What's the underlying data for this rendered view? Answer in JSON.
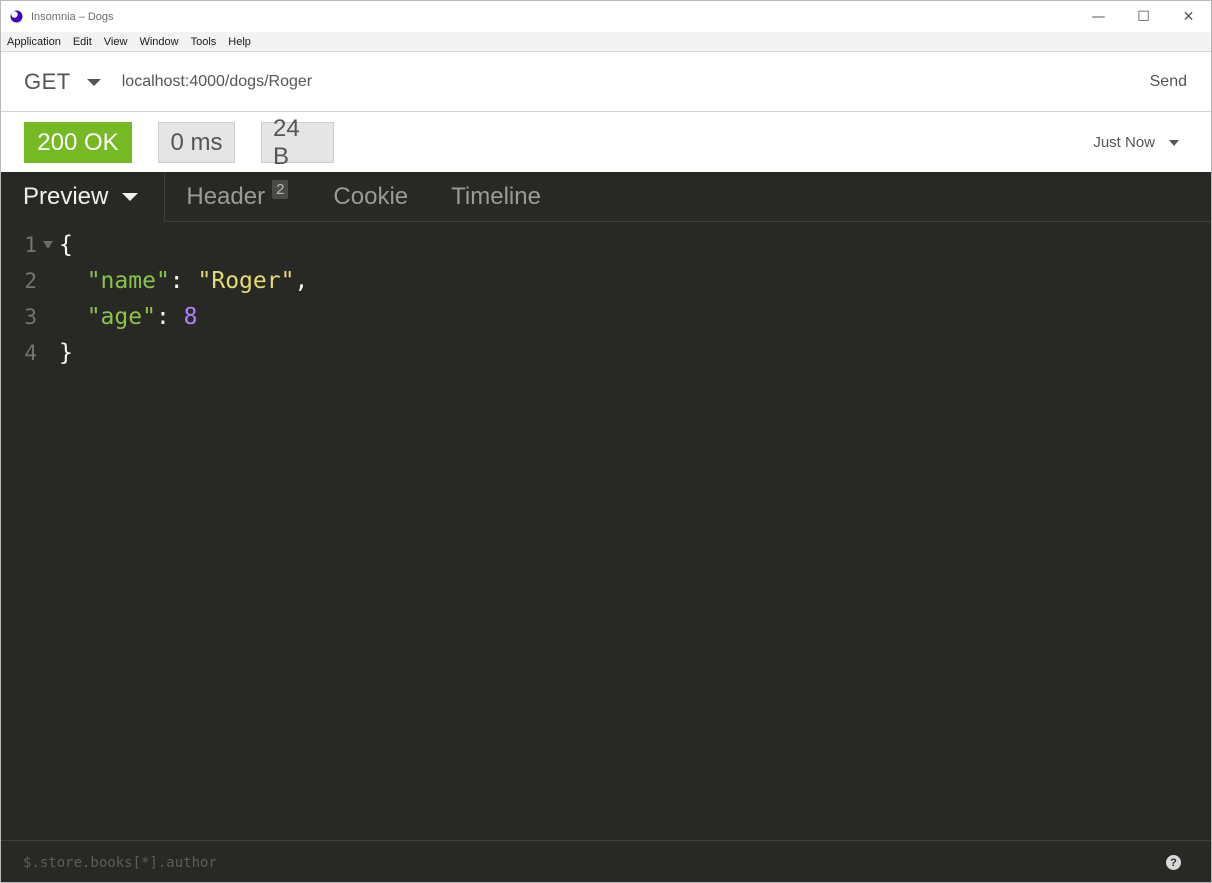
{
  "window": {
    "title": "Insomnia – Dogs",
    "controls": {
      "minimize": "—",
      "maximize": "☐",
      "close": "✕"
    }
  },
  "menu": [
    "Application",
    "Edit",
    "View",
    "Window",
    "Tools",
    "Help"
  ],
  "request": {
    "method": "GET",
    "url": "localhost:4000/dogs/Roger",
    "send_label": "Send"
  },
  "response": {
    "status": "200 OK",
    "status_color": "#75ba24",
    "time": "0 ms",
    "size": "24 B",
    "history": "Just Now"
  },
  "tabs": {
    "preview": "Preview",
    "header": "Header",
    "header_count": "2",
    "cookie": "Cookie",
    "timeline": "Timeline"
  },
  "body": {
    "lines": [
      "1",
      "2",
      "3",
      "4"
    ],
    "open_brace": "{",
    "close_brace": "}",
    "key_name": "\"name\"",
    "val_name": "\"Roger\"",
    "key_age": "\"age\"",
    "val_age": "8",
    "colon": ": ",
    "comma": ","
  },
  "filter": {
    "placeholder": "$.store.books[*].author",
    "help_icon": "?"
  }
}
